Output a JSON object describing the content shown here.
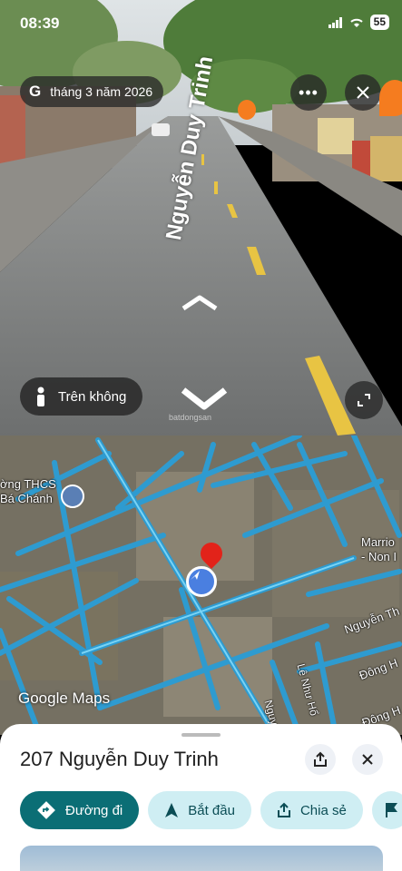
{
  "status_bar": {
    "time": "08:39",
    "battery": "55"
  },
  "street_view": {
    "provider_icon": "google-g-icon",
    "date_label": "tháng 3 năm 2026",
    "street_name": "Nguyễn Duy Trinh",
    "mode_label": "Trên không",
    "watermark": "batdongsan"
  },
  "map": {
    "labels": {
      "school": "ờng THCS\nBá Chánh",
      "marriott": "Marrio\n- Non I",
      "nguyen_th": "Nguyễn Th",
      "le_nhu_ho": "Lê Như Hổ",
      "dong_h1": "Đông H",
      "dong_h2": "Đông H",
      "nguy": "Nguy"
    },
    "attribution": "Google Maps",
    "road_color": "#3fb4e6"
  },
  "sheet": {
    "title": "207 Nguyễn Duy Trinh",
    "actions": [
      {
        "label": "Đường đi",
        "icon": "directions-icon"
      },
      {
        "label": "Bắt đầu",
        "icon": "navigation-icon"
      },
      {
        "label": "Chia sẻ",
        "icon": "share-icon"
      },
      {
        "label": "",
        "icon": "flag-icon"
      }
    ]
  },
  "colors": {
    "primary": "#0b6e75",
    "secondary": "#cfeef3"
  }
}
